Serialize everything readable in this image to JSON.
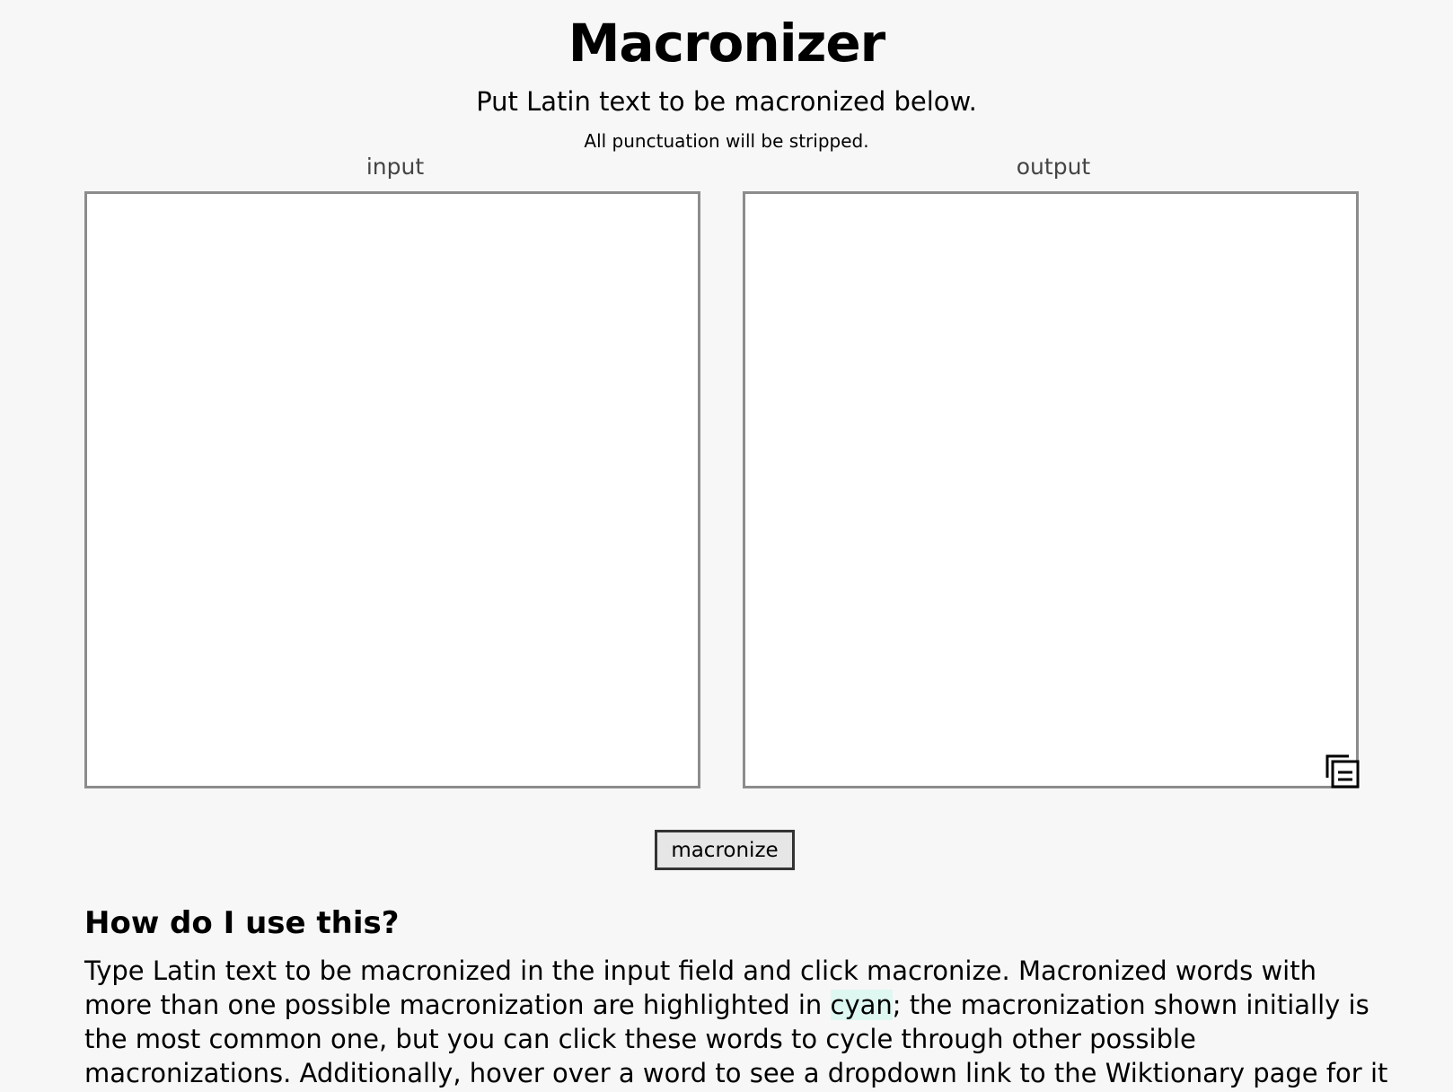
{
  "header": {
    "title": "Macronizer",
    "subtitle": "Put Latin text to be macronized below.",
    "note": "All punctuation will be stripped."
  },
  "input_pane": {
    "label": "input",
    "value": ""
  },
  "output_pane": {
    "label": "output",
    "value": "",
    "copy_icon": "copy-icon"
  },
  "actions": {
    "macronize_label": "macronize"
  },
  "help": {
    "heading": "How do I use this?",
    "line1": "Type Latin text to be macronized in the input field and click macronize. Macronized words with",
    "line2_before": "more than one possible macronization are highlighted in ",
    "line2_highlight": "cyan",
    "line2_after": "; the macronization shown initially is",
    "line3": "the most common one, but you can click these words to cycle through other possible",
    "line4": "macronizations. Additionally, hover over a word to see a dropdown link to the Wiktionary page for it"
  },
  "colors": {
    "background": "#f7f7f7",
    "highlight": "#dff7f1",
    "box_border": "#8c8c8c"
  }
}
